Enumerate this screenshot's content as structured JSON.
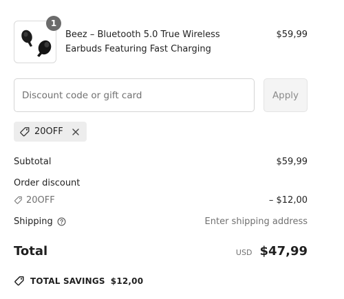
{
  "product": {
    "quantity": "1",
    "name": "Beez – Bluetooth 5.0 True Wireless Earbuds Featuring Fast Charging",
    "price": "$59,99"
  },
  "discount": {
    "placeholder": "Discount code or gift card",
    "value": "",
    "apply_label": "Apply",
    "applied_code": "20OFF"
  },
  "summary": {
    "subtotal_label": "Subtotal",
    "subtotal_value": "$59,99",
    "order_discount_label": "Order discount",
    "discount_code": "20OFF",
    "discount_value": "– $12,00",
    "shipping_label": "Shipping",
    "shipping_value": "Enter shipping address"
  },
  "total": {
    "label": "Total",
    "currency": "USD",
    "amount": "$47,99"
  },
  "savings": {
    "label": "TOTAL SAVINGS",
    "amount": "$12,00"
  },
  "icons": {
    "tag": "tag-icon",
    "close": "close-icon",
    "info": "info-icon",
    "product": "earbuds-product-image"
  }
}
